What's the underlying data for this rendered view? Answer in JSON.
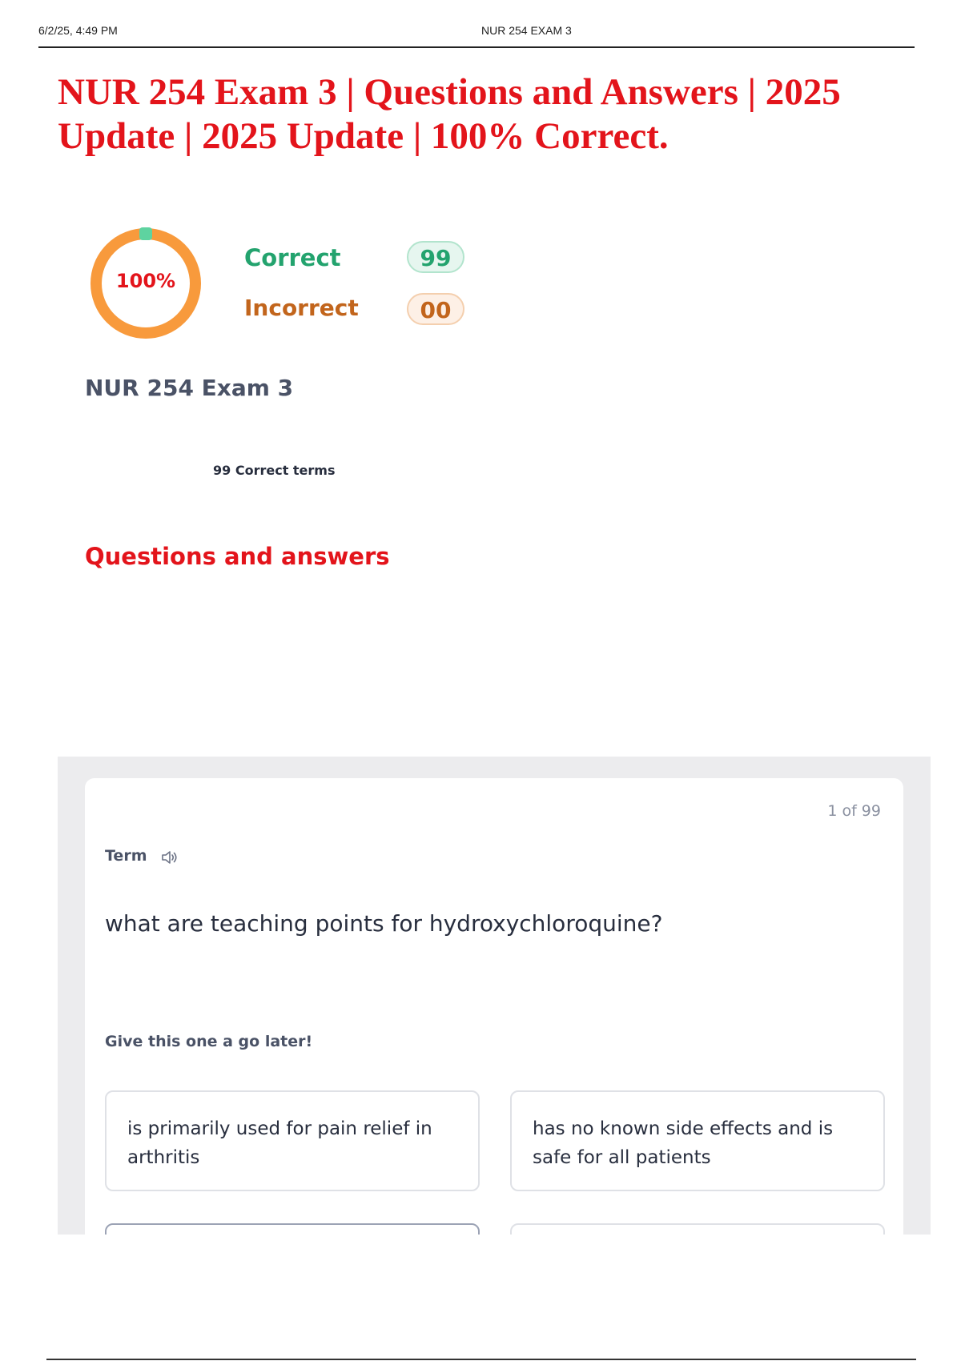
{
  "print_header": {
    "datetime": "6/2/25, 4:49 PM",
    "page_title": "NUR 254 EXAM 3"
  },
  "document": {
    "title": "NUR 254 Exam 3 | Questions and Answers | 2025 Update | 2025 Update | 100% Correct."
  },
  "score": {
    "percent_label": "100%",
    "percent_value": 100,
    "correct_label": "Correct",
    "correct_count": "99",
    "incorrect_label": "Incorrect",
    "incorrect_count": "00"
  },
  "set": {
    "title": "NUR 254 Exam 3",
    "terms_summary": "99 Correct terms"
  },
  "section": {
    "title": "Questions and answers"
  },
  "card": {
    "counter": "1 of 99",
    "term_label": "Term",
    "question": "what are teaching points for hydroxychloroquine?",
    "later_prompt": "Give this one a go later!",
    "options": [
      {
        "text": "is primarily used for pain relief in arthritis"
      },
      {
        "text": "has no known side effects and is safe for all patients"
      },
      {
        "text": ""
      },
      {
        "text": ""
      }
    ]
  },
  "colors": {
    "accent_red": "#e3141b",
    "correct_green": "#23a36e",
    "incorrect_orange": "#c2651c",
    "ring_orange": "#f89a3c",
    "ring_marker": "#5ed3a0"
  },
  "icons": {
    "speaker": "speaker-icon"
  }
}
